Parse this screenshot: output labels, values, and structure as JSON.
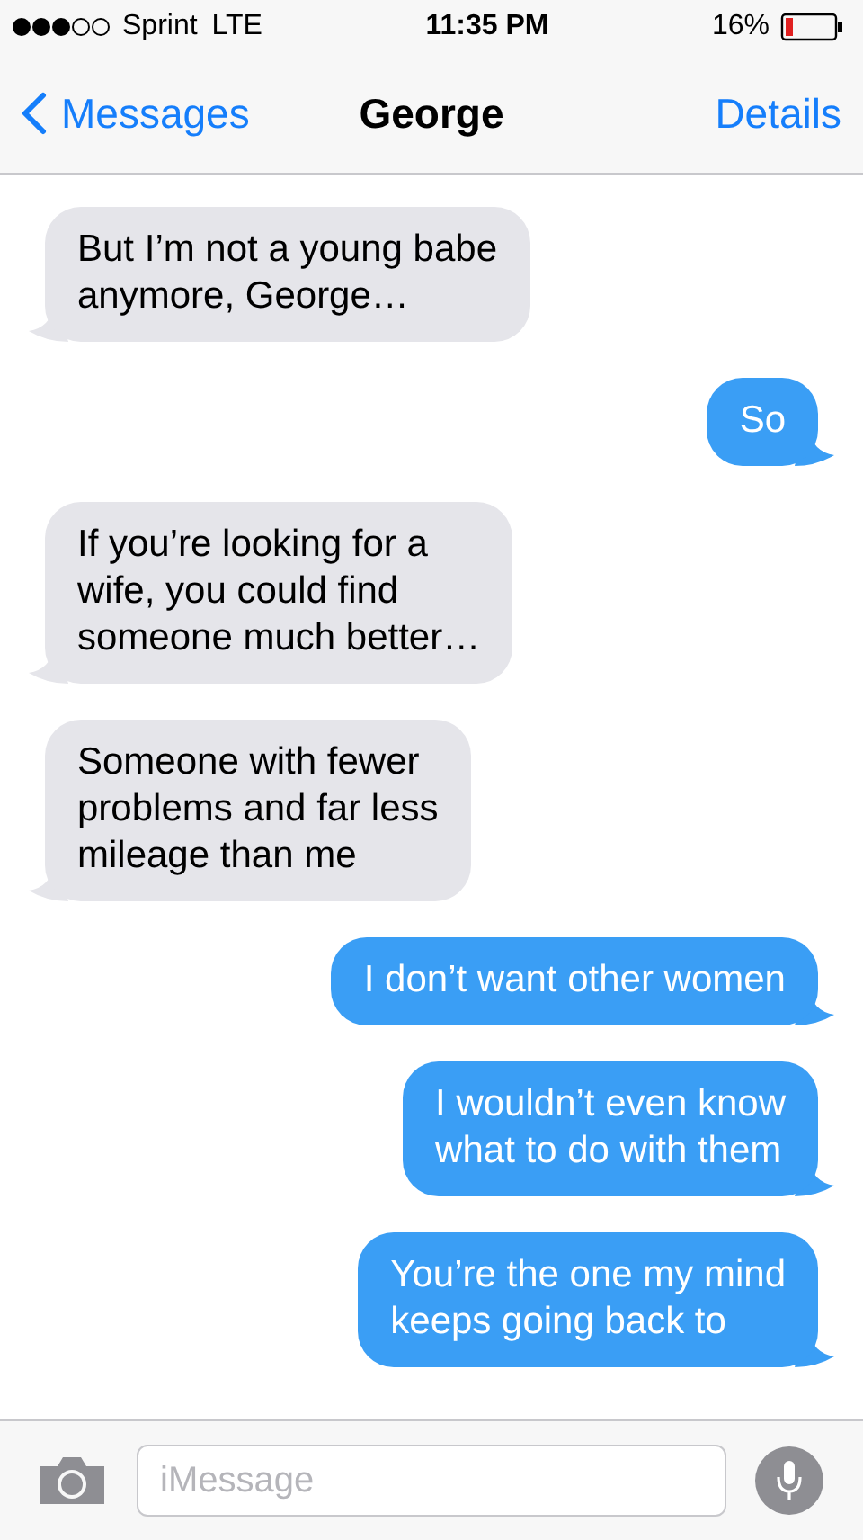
{
  "status_bar": {
    "carrier": "Sprint",
    "network": "LTE",
    "time": "11:35 PM",
    "battery": "16%"
  },
  "nav": {
    "back": "Messages",
    "title": "George",
    "action": "Details"
  },
  "messages": [
    {
      "kind": "received",
      "text": "But I’m not a young babe\nanymore, George…"
    },
    {
      "kind": "sent",
      "text": "So"
    },
    {
      "kind": "received",
      "text": "If you’re looking for a\nwife, you could find\nsomeone much better…"
    },
    {
      "kind": "received",
      "text": "Someone with fewer\nproblems and far less\nmileage than me"
    },
    {
      "kind": "sent",
      "text": "I don’t want other women"
    },
    {
      "kind": "sent",
      "text": "I wouldn’t even know\nwhat to do with them"
    },
    {
      "kind": "sent",
      "text": "You’re the one my mind\nkeeps going back to"
    }
  ],
  "composer": {
    "placeholder": "iMessage"
  }
}
